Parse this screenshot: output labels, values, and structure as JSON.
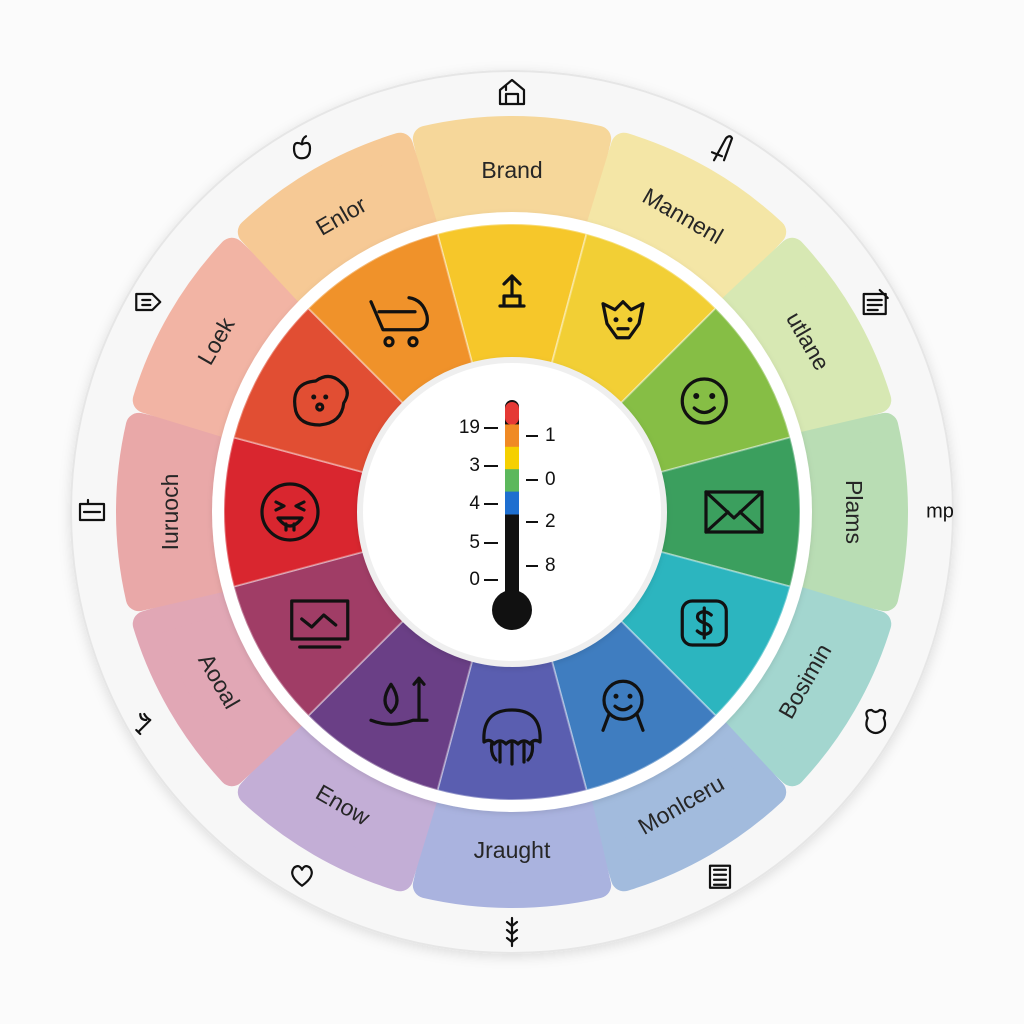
{
  "wheel": {
    "petals": [
      {
        "label": "Brand",
        "color": "#f6d79a"
      },
      {
        "label": "Mannenl",
        "color": "#f4e6a6"
      },
      {
        "label": "utlane",
        "color": "#d7e8b3"
      },
      {
        "label": "Plams",
        "color": "#b9ddb4"
      },
      {
        "label": "Bosimin",
        "color": "#a3d6cf"
      },
      {
        "label": "Monlceru",
        "color": "#a2bbdd"
      },
      {
        "label": "Jraught",
        "color": "#aab3df"
      },
      {
        "label": "Enow",
        "color": "#c3aed6"
      },
      {
        "label": "Aooal",
        "color": "#e1a7b5"
      },
      {
        "label": "Iuruoch",
        "color": "#e9a8a8"
      },
      {
        "label": "Loek",
        "color": "#f2b4a4"
      },
      {
        "label": "Enlor",
        "color": "#f6c995"
      }
    ],
    "segments": [
      {
        "color": "#f6c72a",
        "icon": "pedestal-arrow-icon"
      },
      {
        "color": "#f2cf35",
        "icon": "cat-face-icon"
      },
      {
        "color": "#86be45",
        "icon": "smiley-icon"
      },
      {
        "color": "#3b9f5e",
        "icon": "envelope-icon"
      },
      {
        "color": "#2cb5bf",
        "icon": "dollar-icon"
      },
      {
        "color": "#3f7dc0",
        "icon": "person-icon"
      },
      {
        "color": "#5a5eb0",
        "icon": "jellyfish-icon"
      },
      {
        "color": "#6a3f86",
        "icon": "drop-arrow-icon"
      },
      {
        "color": "#a03d66",
        "icon": "monitor-chart-icon"
      },
      {
        "color": "#d9262f",
        "icon": "laughing-face-icon"
      },
      {
        "color": "#e14e33",
        "icon": "blob-face-icon"
      },
      {
        "color": "#f0922a",
        "icon": "cart-icon"
      }
    ],
    "thermometer": {
      "left_ticks": [
        "19",
        "3",
        "4",
        "5",
        "0"
      ],
      "right_ticks": [
        "1",
        "0",
        "2",
        "8"
      ],
      "scale_colors": [
        "#e53935",
        "#f08a24",
        "#f5d000",
        "#5cb85c",
        "#1e6fd0"
      ]
    },
    "outer_icons": [
      "house-icon",
      "pen-icon",
      "note-icon",
      "mp-label",
      "bug-icon",
      "keyboard-icon",
      "spine-icon",
      "heart-icon",
      "wrench-icon",
      "card-icon",
      "tag-icon",
      "apple-icon"
    ],
    "outer_text": {
      "mp": "mp"
    }
  }
}
